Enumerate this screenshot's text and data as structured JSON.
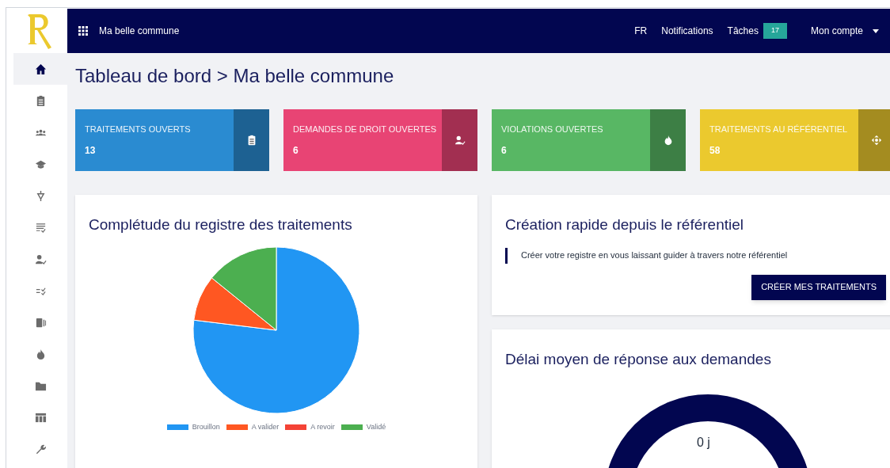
{
  "topbar": {
    "app_name": "Ma belle commune",
    "language": "FR",
    "notifications": "Notifications",
    "tasks": {
      "label": "Tâches",
      "count": "17"
    },
    "account": "Mon compte"
  },
  "sidebar": {
    "items": [
      {
        "selected": true
      },
      {
        "selected": false
      },
      {
        "selected": false
      },
      {
        "selected": false
      },
      {
        "selected": false
      },
      {
        "selected": false
      },
      {
        "selected": false
      },
      {
        "selected": false
      },
      {
        "selected": false
      },
      {
        "selected": false
      },
      {
        "selected": false
      },
      {
        "selected": false
      },
      {
        "selected": false
      }
    ]
  },
  "page_title": "Tableau de bord > Ma belle commune",
  "stat_cards": [
    {
      "label": "TRAITEMENTS OUVERTS",
      "value": "13",
      "color": "#2a8bd1"
    },
    {
      "label": "DEMANDES DE DROIT OUVERTES",
      "value": "6",
      "color": "#e84474"
    },
    {
      "label": "VIOLATIONS OUVERTES",
      "value": "6",
      "color": "#58b764"
    },
    {
      "label": "TRAITEMENTS AU RÉFÉRENTIEL",
      "value": "58",
      "color": "#ebc92e"
    }
  ],
  "completeness_panel": {
    "title": "Complétude du registre des traitements",
    "legend": [
      {
        "label": "Brouillon",
        "color": "#2196f3"
      },
      {
        "label": "A valider",
        "color": "#ff5722"
      },
      {
        "label": "A revoir",
        "color": "#f44336"
      },
      {
        "label": "Validé",
        "color": "#4caf50"
      }
    ]
  },
  "quick_create_panel": {
    "title": "Création rapide depuis le référentiel",
    "text": "Créer votre registre en vous laissant guider à travers notre référentiel",
    "button": "CRÉER MES TRAITEMENTS"
  },
  "delay_panel": {
    "title": "Délai moyen de réponse aux demandes",
    "value": "0 j"
  }
}
